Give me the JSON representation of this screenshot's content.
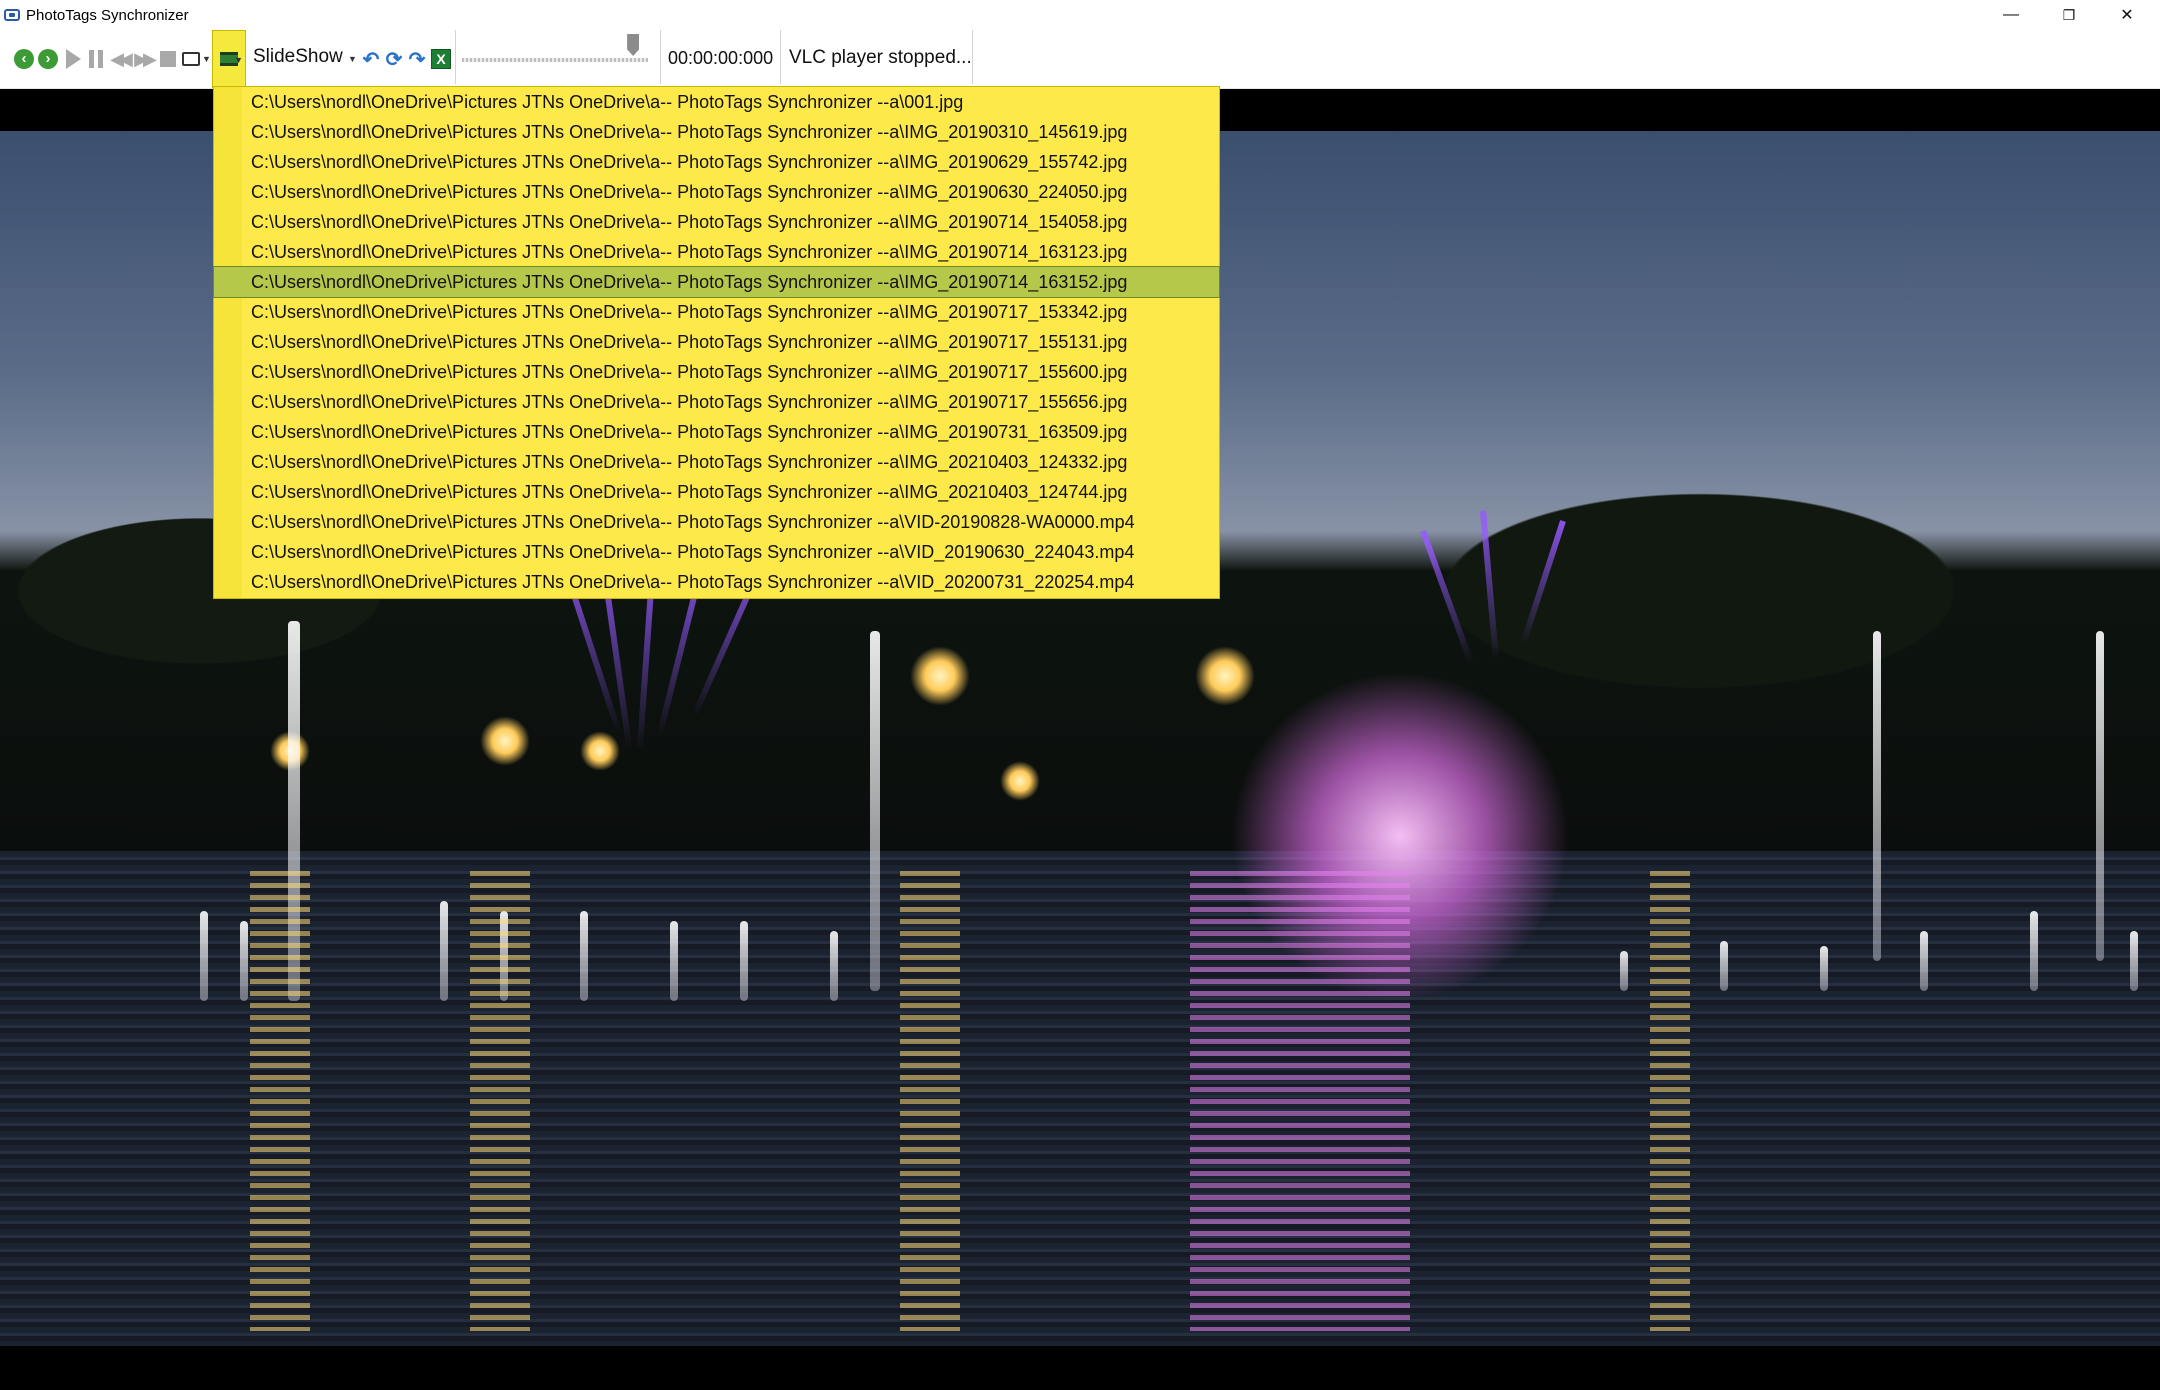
{
  "window": {
    "title": "PhotoTags Synchronizer",
    "minimize_glyph": "—",
    "restore_glyph": "❐",
    "close_glyph": "✕"
  },
  "toolbar": {
    "slideshow_label": "SlideShow",
    "time_display": "00:00:00:000",
    "status": "VLC player stopped...",
    "icons": [
      "back-green-icon",
      "forward-green-icon",
      "play-icon",
      "pause-icon",
      "rewind-icon",
      "fast-forward-icon",
      "stop-icon",
      "cast-icon",
      "playlist-icon",
      "rotate-left-icon",
      "refresh-icon",
      "rotate-right-icon",
      "excel-icon"
    ]
  },
  "media": {
    "seek_position_fraction": 0.92
  },
  "playlist": {
    "selected_index": 6,
    "items": [
      "C:\\Users\\nordl\\OneDrive\\Pictures JTNs OneDrive\\a-- PhotoTags Synchronizer --a\\001.jpg",
      "C:\\Users\\nordl\\OneDrive\\Pictures JTNs OneDrive\\a-- PhotoTags Synchronizer --a\\IMG_20190310_145619.jpg",
      "C:\\Users\\nordl\\OneDrive\\Pictures JTNs OneDrive\\a-- PhotoTags Synchronizer --a\\IMG_20190629_155742.jpg",
      "C:\\Users\\nordl\\OneDrive\\Pictures JTNs OneDrive\\a-- PhotoTags Synchronizer --a\\IMG_20190630_224050.jpg",
      "C:\\Users\\nordl\\OneDrive\\Pictures JTNs OneDrive\\a-- PhotoTags Synchronizer --a\\IMG_20190714_154058.jpg",
      "C:\\Users\\nordl\\OneDrive\\Pictures JTNs OneDrive\\a-- PhotoTags Synchronizer --a\\IMG_20190714_163123.jpg",
      "C:\\Users\\nordl\\OneDrive\\Pictures JTNs OneDrive\\a-- PhotoTags Synchronizer --a\\IMG_20190714_163152.jpg",
      "C:\\Users\\nordl\\OneDrive\\Pictures JTNs OneDrive\\a-- PhotoTags Synchronizer --a\\IMG_20190717_153342.jpg",
      "C:\\Users\\nordl\\OneDrive\\Pictures JTNs OneDrive\\a-- PhotoTags Synchronizer --a\\IMG_20190717_155131.jpg",
      "C:\\Users\\nordl\\OneDrive\\Pictures JTNs OneDrive\\a-- PhotoTags Synchronizer --a\\IMG_20190717_155600.jpg",
      "C:\\Users\\nordl\\OneDrive\\Pictures JTNs OneDrive\\a-- PhotoTags Synchronizer --a\\IMG_20190717_155656.jpg",
      "C:\\Users\\nordl\\OneDrive\\Pictures JTNs OneDrive\\a-- PhotoTags Synchronizer --a\\IMG_20190731_163509.jpg",
      "C:\\Users\\nordl\\OneDrive\\Pictures JTNs OneDrive\\a-- PhotoTags Synchronizer --a\\IMG_20210403_124332.jpg",
      "C:\\Users\\nordl\\OneDrive\\Pictures JTNs OneDrive\\a-- PhotoTags Synchronizer --a\\IMG_20210403_124744.jpg",
      "C:\\Users\\nordl\\OneDrive\\Pictures JTNs OneDrive\\a-- PhotoTags Synchronizer --a\\VID-20190828-WA0000.mp4",
      "C:\\Users\\nordl\\OneDrive\\Pictures JTNs OneDrive\\a-- PhotoTags Synchronizer --a\\VID_20190630_224043.mp4",
      "C:\\Users\\nordl\\OneDrive\\Pictures JTNs OneDrive\\a-- PhotoTags Synchronizer --a\\VID_20200731_220254.mp4"
    ]
  },
  "colors": {
    "dropdown_bg": "#fde94a",
    "selected_row": "#b6c84a",
    "accent_green": "#3d9b35"
  }
}
